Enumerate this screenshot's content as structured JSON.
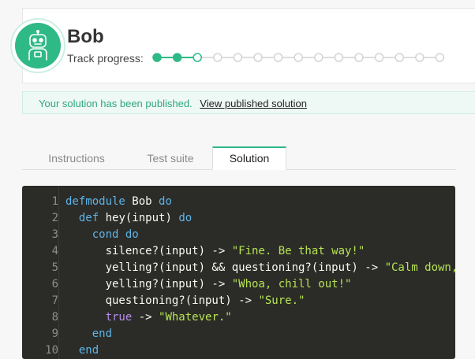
{
  "header": {
    "title": "Bob",
    "progress_label": "Track progress:",
    "progress": {
      "total_steps": 15,
      "completed_steps": 2,
      "current_step": 3
    }
  },
  "banner": {
    "message": "Your solution has been published.",
    "link": "View published solution"
  },
  "tabs": [
    {
      "label": "Instructions",
      "active": false
    },
    {
      "label": "Test suite",
      "active": false
    },
    {
      "label": "Solution",
      "active": true
    }
  ],
  "colors": {
    "brand_green": "#2fb987",
    "code_bg": "#2b2c28",
    "keyword": "#5fb3e8",
    "atom": "#b78dec",
    "string": "#b6e354",
    "text": "#f8f8f2",
    "line_number": "#8e8e8a"
  },
  "code": {
    "line_numbers": [
      "1",
      "2",
      "3",
      "4",
      "5",
      "6",
      "7",
      "8",
      "9",
      "10"
    ],
    "lines": [
      [
        {
          "t": "defmodule",
          "k": "kw"
        },
        {
          "t": " Bob ",
          "k": "txt"
        },
        {
          "t": "do",
          "k": "kw"
        }
      ],
      [
        {
          "t": "  ",
          "k": "txt"
        },
        {
          "t": "def",
          "k": "kw"
        },
        {
          "t": " hey(input) ",
          "k": "txt"
        },
        {
          "t": "do",
          "k": "kw"
        }
      ],
      [
        {
          "t": "    ",
          "k": "txt"
        },
        {
          "t": "cond",
          "k": "kw"
        },
        {
          "t": " ",
          "k": "txt"
        },
        {
          "t": "do",
          "k": "kw"
        }
      ],
      [
        {
          "t": "      silence?(input) -> ",
          "k": "txt"
        },
        {
          "t": "\"Fine. Be that way!\"",
          "k": "str"
        }
      ],
      [
        {
          "t": "      yelling?(input) && questioning?(input) -> ",
          "k": "txt"
        },
        {
          "t": "\"Calm down,",
          "k": "str"
        }
      ],
      [
        {
          "t": "      yelling?(input) -> ",
          "k": "txt"
        },
        {
          "t": "\"Whoa, chill out!\"",
          "k": "str"
        }
      ],
      [
        {
          "t": "      questioning?(input) -> ",
          "k": "txt"
        },
        {
          "t": "\"Sure.\"",
          "k": "str"
        }
      ],
      [
        {
          "t": "      ",
          "k": "txt"
        },
        {
          "t": "true",
          "k": "atom"
        },
        {
          "t": " -> ",
          "k": "txt"
        },
        {
          "t": "\"Whatever.\"",
          "k": "str"
        }
      ],
      [
        {
          "t": "    ",
          "k": "txt"
        },
        {
          "t": "end",
          "k": "kw"
        }
      ],
      [
        {
          "t": "  ",
          "k": "txt"
        },
        {
          "t": "end",
          "k": "kw"
        }
      ]
    ]
  }
}
